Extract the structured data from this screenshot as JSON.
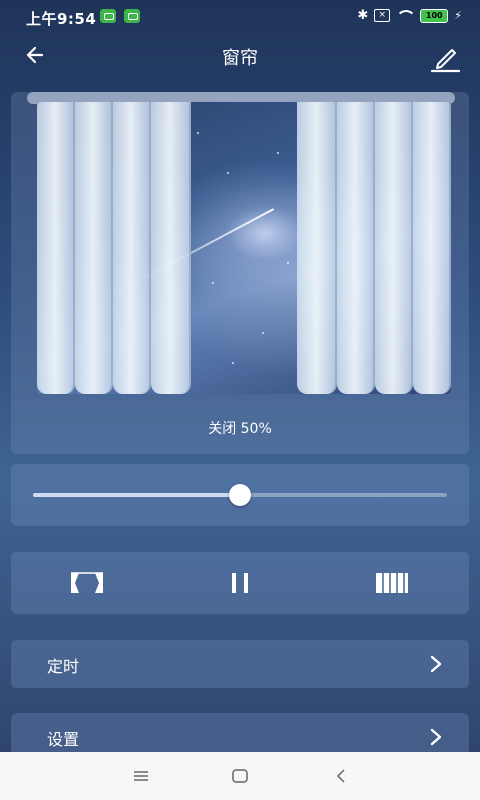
{
  "status_bar": {
    "time": "上午9:54",
    "battery": "100",
    "icons": [
      "notification-icon",
      "notification-icon",
      "bluetooth-icon",
      "no-sim-icon",
      "wifi-icon",
      "battery-icon",
      "charging-icon"
    ]
  },
  "header": {
    "title": "窗帘",
    "back_icon": "arrow-left-icon",
    "edit_icon": "pencil-icon"
  },
  "preview": {
    "status": "关闭 50%",
    "curtain_closed_fraction": 0.5
  },
  "slider": {
    "value_fraction": 0.5
  },
  "controls": {
    "open_icon": "curtain-open-icon",
    "pause_icon": "pause-icon",
    "close_icon": "curtain-close-icon"
  },
  "rows": [
    {
      "label": "定时",
      "icon": "chevron-right-icon"
    },
    {
      "label": "设置",
      "icon": "chevron-right-icon"
    }
  ],
  "nav_bar": {
    "icons": [
      "menu-icon",
      "home-icon",
      "back-icon"
    ]
  },
  "colors": {
    "background_top": "#1f3459",
    "background_mid": "#3f6494",
    "accent": "#ffffff",
    "nav_bar": "#f7f7f7"
  }
}
